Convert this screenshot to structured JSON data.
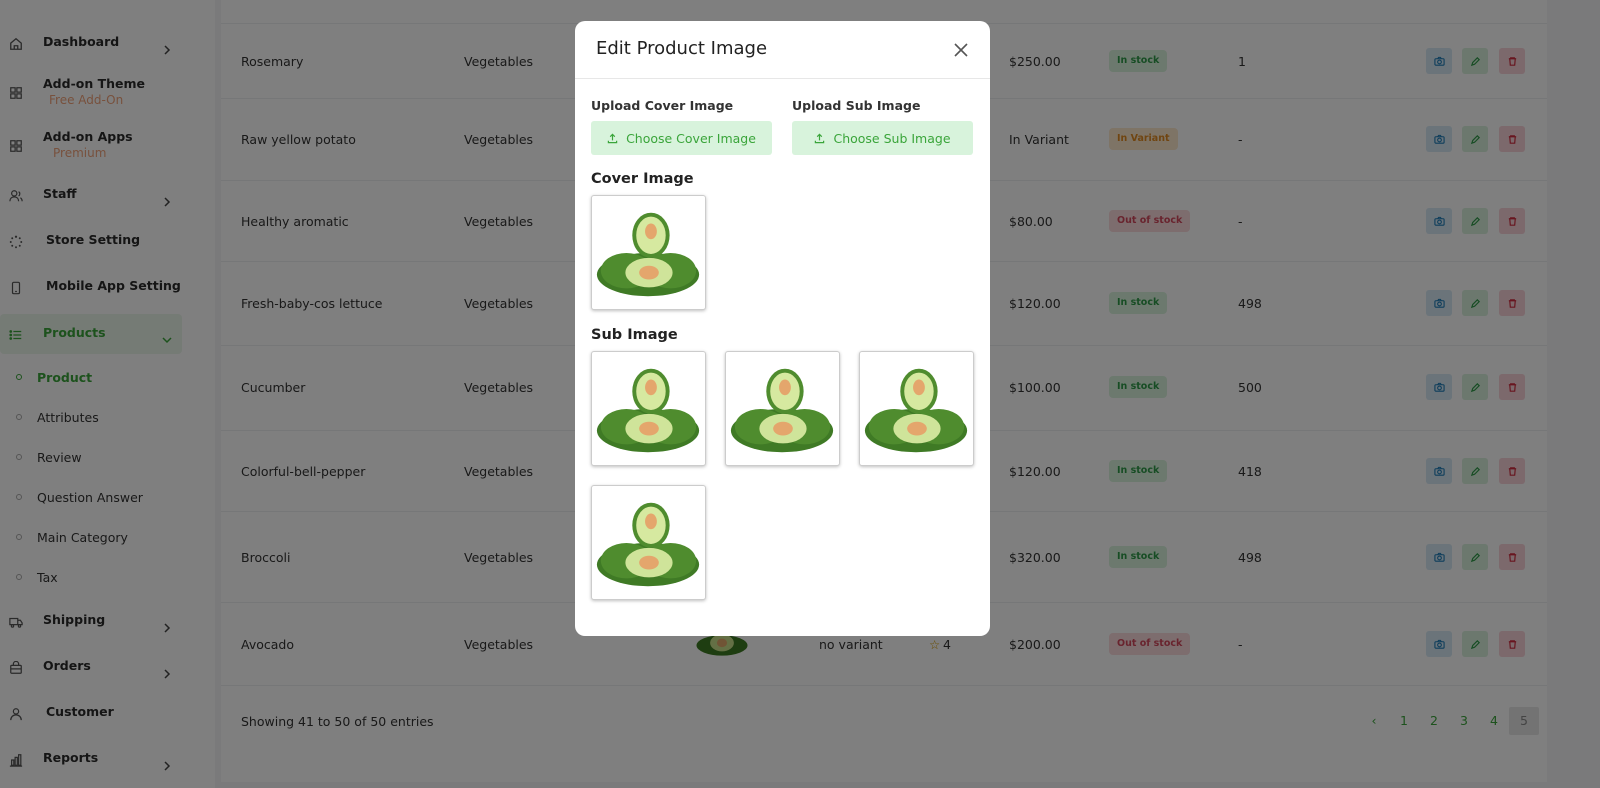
{
  "sidebar": {
    "items": [
      {
        "label": "Dashboard",
        "icon": "home-icon",
        "has_chevron": true
      },
      {
        "label": "Add-on Theme",
        "sub_tag": "Free Add-On",
        "icon": "grid-icon"
      },
      {
        "label": "Add-on Apps",
        "sub_tag": "Premium",
        "icon": "grid-icon"
      },
      {
        "label": "Staff",
        "icon": "users-icon",
        "has_chevron": true
      },
      {
        "label": "Store Setting",
        "icon": "loader-icon"
      },
      {
        "label": "Mobile App Setting",
        "icon": "mobile-icon"
      },
      {
        "label": "Products",
        "icon": "list-icon",
        "has_chevron": true,
        "active": true
      },
      {
        "label": "Shipping",
        "icon": "truck-icon",
        "has_chevron": true
      },
      {
        "label": "Orders",
        "icon": "bag-icon",
        "has_chevron": true
      },
      {
        "label": "Customer",
        "icon": "user-icon"
      },
      {
        "label": "Reports",
        "icon": "chart-icon",
        "has_chevron": true
      }
    ],
    "product_subitems": [
      "Product",
      "Attributes",
      "Review",
      "Question Answer",
      "Main Category",
      "Tax"
    ]
  },
  "table": {
    "rows": [
      {
        "name": "Rosemary",
        "category": "Vegetables",
        "price": "$250.00",
        "status": "In stock",
        "stock": "1"
      },
      {
        "name": "Raw yellow potato",
        "category": "Vegetables",
        "price": "In Variant",
        "status": "In Variant",
        "stock": "-"
      },
      {
        "name": "Healthy aromatic",
        "category": "Vegetables",
        "price": "$80.00",
        "status": "Out of stock",
        "stock": "-"
      },
      {
        "name": "Fresh-baby-cos lettuce",
        "category": "Vegetables",
        "price": "$120.00",
        "status": "In stock",
        "stock": "498"
      },
      {
        "name": "Cucumber",
        "category": "Vegetables",
        "price": "$100.00",
        "status": "In stock",
        "stock": "500"
      },
      {
        "name": "Colorful-bell-pepper",
        "category": "Vegetables",
        "price": "$120.00",
        "status": "In stock",
        "stock": "418"
      },
      {
        "name": "Broccoli",
        "category": "Vegetables",
        "price": "$320.00",
        "status": "In stock",
        "stock": "498"
      },
      {
        "name": "Avocado",
        "category": "Vegetables",
        "variant": "no variant",
        "rating": "4",
        "price": "$200.00",
        "status": "Out of stock",
        "stock": "-"
      }
    ],
    "footer": "Showing 41 to 50 of 50 entries",
    "pagination": {
      "prev": "‹",
      "pages": [
        "1",
        "2",
        "3",
        "4",
        "5"
      ],
      "current": "5"
    }
  },
  "modal": {
    "title": "Edit Product Image",
    "upload_cover_label": "Upload Cover Image",
    "upload_sub_label": "Upload Sub Image",
    "choose_cover_button": "Choose Cover Image",
    "choose_sub_button": "Choose Sub Image",
    "cover_section_title": "Cover Image",
    "sub_section_title": "Sub Image"
  },
  "colors": {
    "accent": "#3aa53a",
    "accent_light": "#d8f3dc",
    "danger": "#d02a3e",
    "info": "#1b7bb7"
  }
}
